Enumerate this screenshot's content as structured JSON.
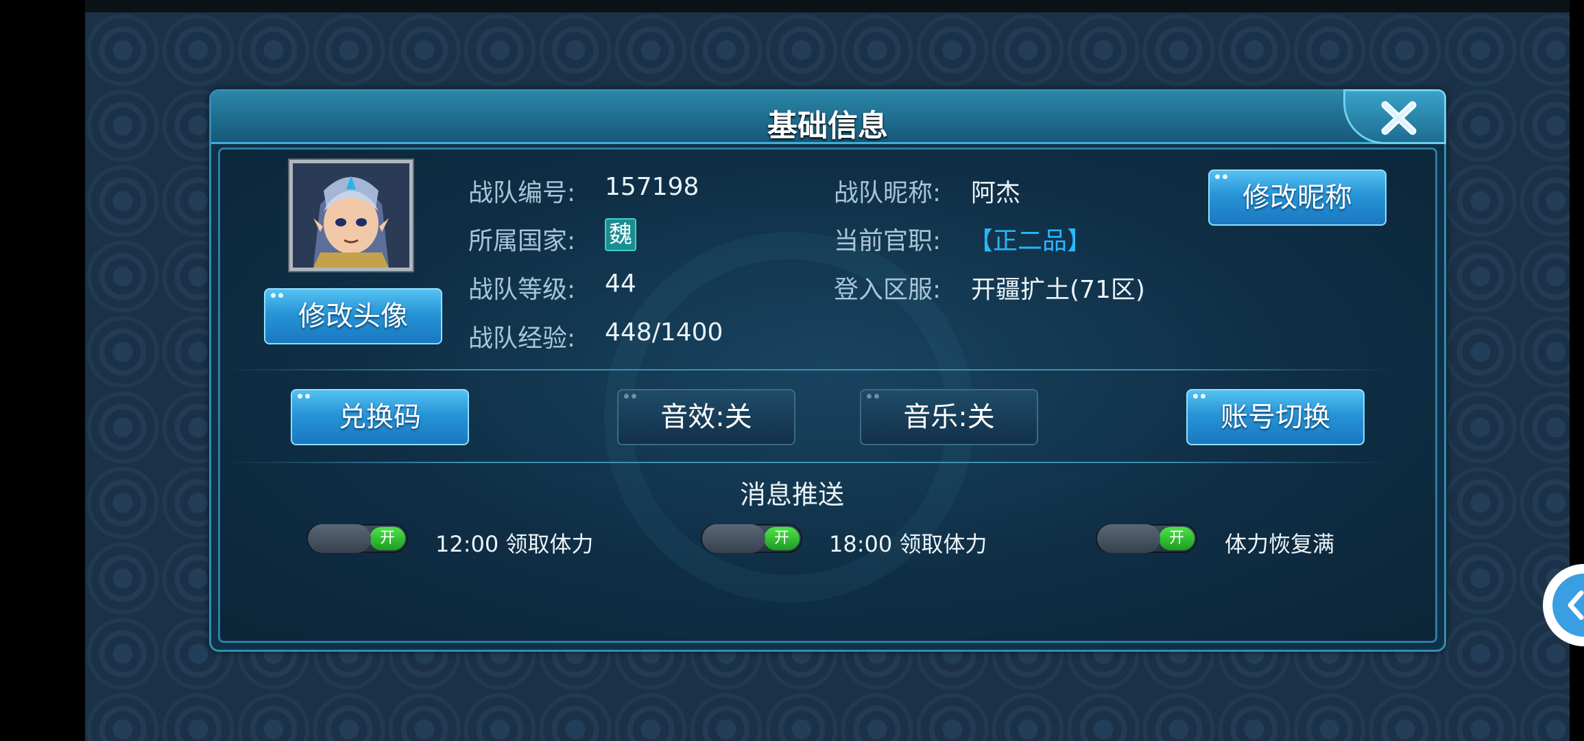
{
  "dialog": {
    "title": "基础信息"
  },
  "profile": {
    "team_id_label": "战队编号:",
    "team_id": "157198",
    "country_label": "所属国家:",
    "country": "魏",
    "level_label": "战队等级:",
    "level": "44",
    "exp_label": "战队经验:",
    "exp": "448/1400",
    "nickname_label": "战队昵称:",
    "nickname": "阿杰",
    "rank_label": "当前官职:",
    "rank": "【正二品】",
    "server_label": "登入区服:",
    "server": "开疆扩土(71区)"
  },
  "buttons": {
    "change_avatar": "修改头像",
    "change_nickname": "修改昵称",
    "redeem_code": "兑换码",
    "sound_effects": "音效:关",
    "music": "音乐:关",
    "switch_account": "账号切换"
  },
  "push": {
    "title": "消息推送",
    "items": [
      {
        "toggle": "开",
        "label": "12:00  领取体力"
      },
      {
        "toggle": "开",
        "label": "18:00  领取体力"
      },
      {
        "toggle": "开",
        "label": "体力恢复满"
      }
    ]
  },
  "colors": {
    "accent": "#2794d6",
    "rank": "#29b7ff",
    "toggle_on": "#1c9d1f"
  }
}
